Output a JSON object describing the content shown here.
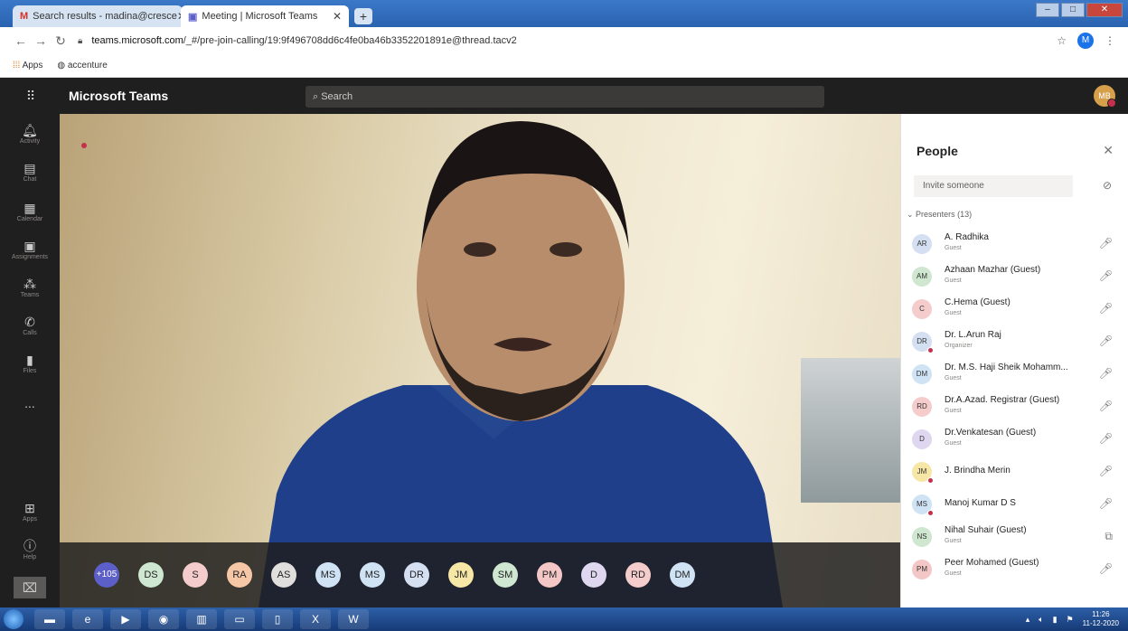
{
  "browser": {
    "tabs": [
      {
        "label": "Search results - madina@cresce",
        "icon": "gmail-icon"
      },
      {
        "label": "Meeting | Microsoft Teams",
        "icon": "teams-icon"
      }
    ],
    "url_host": "teams.microsoft.com",
    "url_path": "/_#/pre-join-calling/19:9f496708dd6c4fe0ba46b3352201891e@thread.tacv2",
    "profile_initial": "M",
    "bookmarks": [
      "Apps",
      "accenture"
    ]
  },
  "teams": {
    "app_title": "Microsoft Teams",
    "search_placeholder": "Search",
    "user_initials": "MB",
    "rail": [
      {
        "label": "Activity",
        "icon": "bell-icon"
      },
      {
        "label": "Chat",
        "icon": "chat-icon"
      },
      {
        "label": "Calendar",
        "icon": "calendar-icon"
      },
      {
        "label": "Assignments",
        "icon": "assignments-icon"
      },
      {
        "label": "Teams",
        "icon": "teams-icon"
      },
      {
        "label": "Calls",
        "icon": "phone-icon"
      },
      {
        "label": "Files",
        "icon": "file-icon"
      },
      {
        "label": "...",
        "icon": "more-icon"
      },
      {
        "label": "Apps",
        "icon": "apps-icon"
      },
      {
        "label": "Help",
        "icon": "help-icon"
      }
    ]
  },
  "roster": {
    "more_count": "+105",
    "chips": [
      {
        "initials": "DS",
        "color": "#cfe6d0"
      },
      {
        "initials": "S",
        "color": "#f4cccc"
      },
      {
        "initials": "RA",
        "color": "#f6c7a6"
      },
      {
        "initials": "AS",
        "color": "#e1dfdd"
      },
      {
        "initials": "MS",
        "color": "#cfe3f4"
      },
      {
        "initials": "MS",
        "color": "#cfe3f4"
      },
      {
        "initials": "DR",
        "color": "#d4dff2"
      },
      {
        "initials": "JM",
        "color": "#f6e7a6"
      },
      {
        "initials": "SM",
        "color": "#cfe6d0"
      },
      {
        "initials": "PM",
        "color": "#f4c7c7"
      },
      {
        "initials": "D",
        "color": "#dfd7f0"
      },
      {
        "initials": "RD",
        "color": "#f4cccc"
      },
      {
        "initials": "DM",
        "color": "#cfe3f4"
      }
    ]
  },
  "people_panel": {
    "title": "People",
    "invite_placeholder": "Invite someone",
    "section_label": "Presenters (13)",
    "people": [
      {
        "initials": "AR",
        "name": "A. Radhika",
        "role": "Guest",
        "avatar_color": "#d4dff2",
        "red_dot": false,
        "mic": "mic-off-icon"
      },
      {
        "initials": "AM",
        "name": "Azhaan Mazhar (Guest)",
        "role": "Guest",
        "avatar_color": "#cfe6d0",
        "red_dot": false,
        "mic": "mic-off-icon"
      },
      {
        "initials": "C",
        "name": "C.Hema (Guest)",
        "role": "Guest",
        "avatar_color": "#f4cccc",
        "red_dot": false,
        "mic": "mic-off-icon"
      },
      {
        "initials": "DR",
        "name": "Dr. L.Arun Raj",
        "role": "Organizer",
        "avatar_color": "#d4dff2",
        "red_dot": true,
        "mic": "mic-off-icon"
      },
      {
        "initials": "DM",
        "name": "Dr. M.S. Haji Sheik Mohamm...",
        "role": "Guest",
        "avatar_color": "#cfe3f4",
        "red_dot": false,
        "mic": "mic-off-icon"
      },
      {
        "initials": "RD",
        "name": "Dr.A.Azad. Registrar (Guest)",
        "role": "Guest",
        "avatar_color": "#f4cccc",
        "red_dot": false,
        "mic": "mic-off-icon"
      },
      {
        "initials": "D",
        "name": "Dr.Venkatesan (Guest)",
        "role": "Guest",
        "avatar_color": "#dfd7f0",
        "red_dot": false,
        "mic": "mic-off-icon"
      },
      {
        "initials": "JM",
        "name": "J. Brindha Merin",
        "role": "",
        "avatar_color": "#f6e7a6",
        "red_dot": true,
        "mic": "mic-off-icon"
      },
      {
        "initials": "MS",
        "name": "Manoj Kumar D S",
        "role": "",
        "avatar_color": "#cfe3f4",
        "red_dot": true,
        "mic": "mic-off-icon"
      },
      {
        "initials": "NS",
        "name": "Nihal Suhair (Guest)",
        "role": "Guest",
        "avatar_color": "#cfe6d0",
        "red_dot": false,
        "mic": "screen-share-icon"
      },
      {
        "initials": "PM",
        "name": "Peer Mohamed (Guest)",
        "role": "Guest",
        "avatar_color": "#f4c7c7",
        "red_dot": false,
        "mic": "mic-off-icon"
      }
    ]
  },
  "taskbar": {
    "clock_time": "11:26",
    "clock_date": "11-12-2020"
  }
}
